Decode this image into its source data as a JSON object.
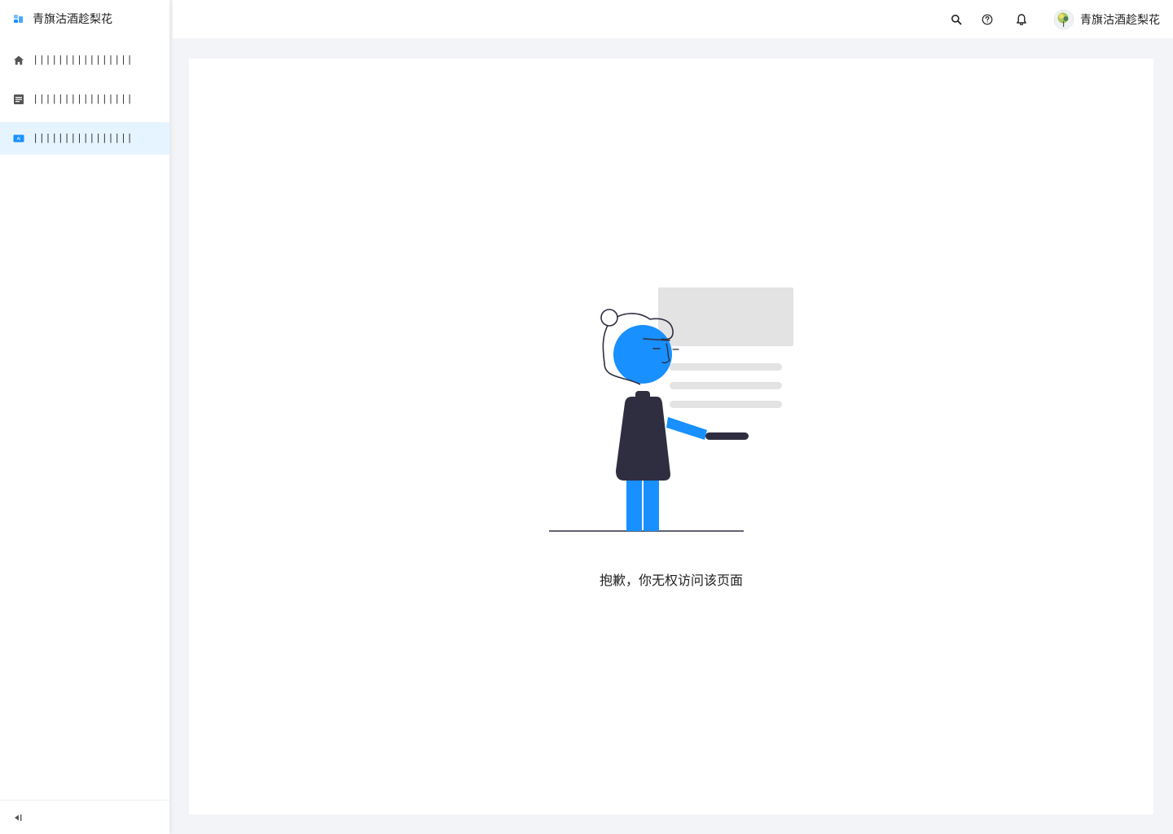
{
  "app": {
    "brand_name": "青旗沽酒趁梨花"
  },
  "sidebar": {
    "items": [
      {
        "label": "||||||||||||||||",
        "icon": "home-icon",
        "active": false
      },
      {
        "label": "||||||||||||||||",
        "icon": "document-icon",
        "active": false
      },
      {
        "label": "||||||||||||||||",
        "icon": "ai-icon",
        "active": true
      }
    ],
    "collapse_icon": "collapse-sidebar-icon"
  },
  "header": {
    "icons": [
      "search-icon",
      "help-icon",
      "bell-icon"
    ],
    "user_name": "青旗沽酒趁梨花"
  },
  "main": {
    "message": "抱歉，你无权访问该页面"
  },
  "colors": {
    "accent": "#1890ff",
    "active_bg": "#e6f4ff",
    "figure_dark": "#2f2e41",
    "placeholder_gray": "#e3e3e3"
  }
}
